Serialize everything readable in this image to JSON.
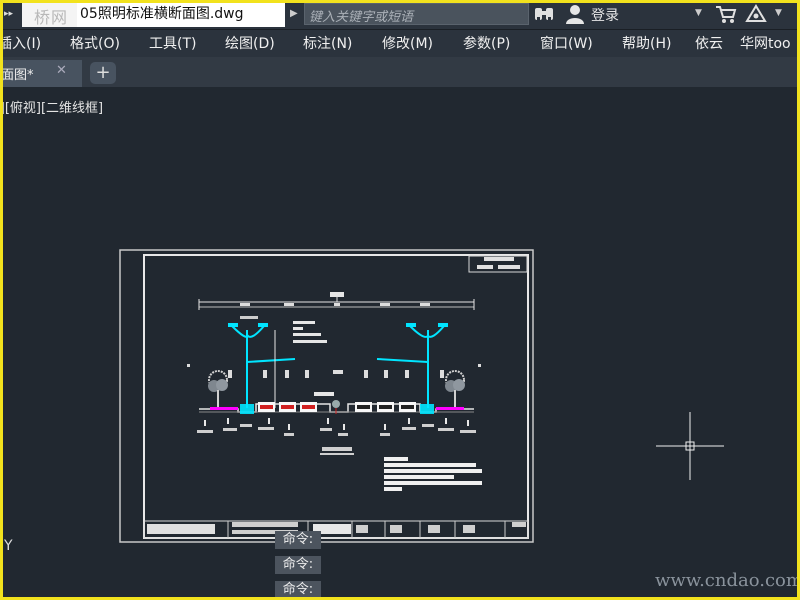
{
  "titlebar": {
    "logo_text": "桥网",
    "file_name": "05照明标准横断面图.dwg",
    "search_placeholder": "键入关键字或短语",
    "login_label": "登录"
  },
  "menu": {
    "items": [
      "插入(I)",
      "格式(O)",
      "工具(T)",
      "绘图(D)",
      "标注(N)",
      "修改(M)",
      "参数(P)",
      "窗口(W)",
      "帮助(H)",
      "依云",
      "华网too"
    ]
  },
  "tabs": {
    "active_label": "断面图*",
    "close_glyph": "✕",
    "add_glyph": "+"
  },
  "viewport": {
    "view_label": "[-][俯视][二维线框]",
    "ucs_label": "Y",
    "commands": [
      "命令:",
      "命令:",
      "命令:"
    ]
  },
  "watermark": "www.cndao.com",
  "colors": {
    "canvas": "#212830",
    "cyan": "#00e5ff",
    "magenta": "#ff00ff",
    "frame": "#f2e21d"
  }
}
